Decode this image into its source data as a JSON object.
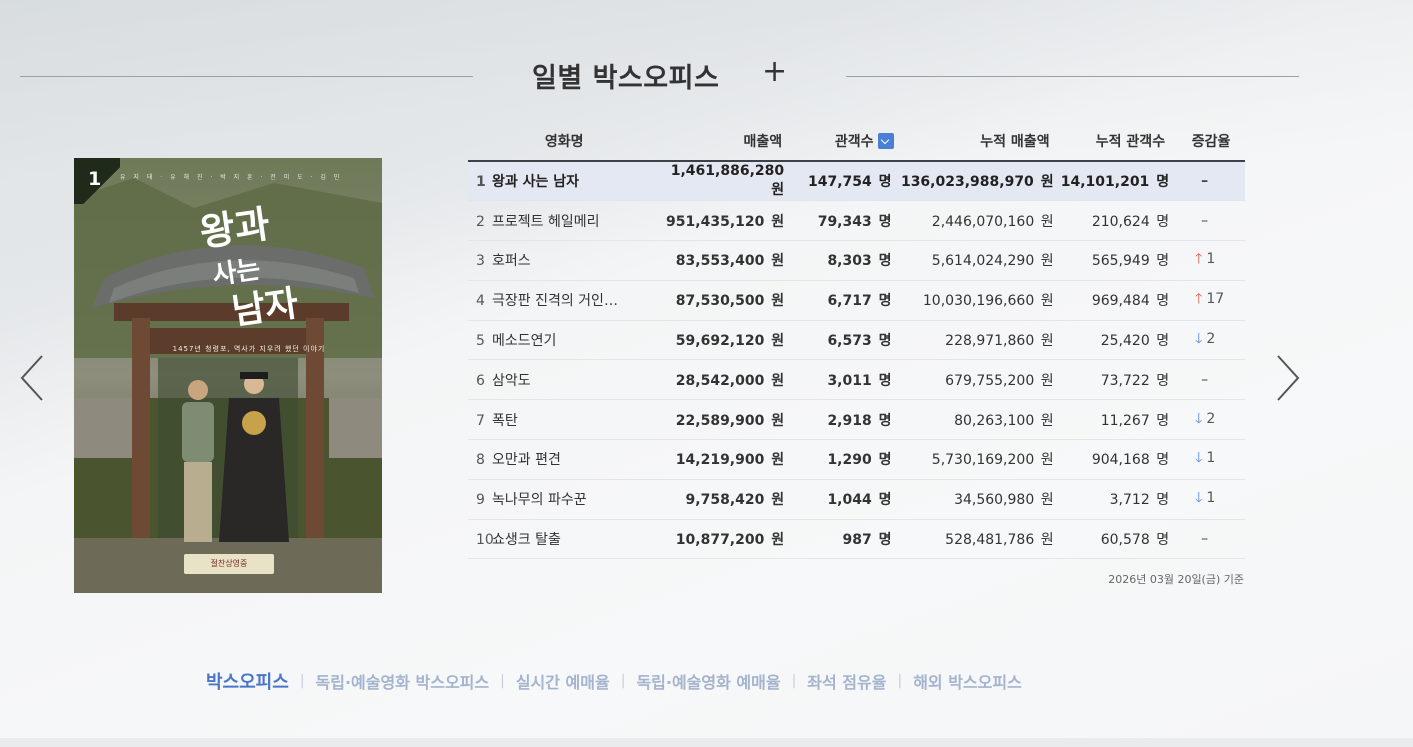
{
  "header": {
    "title": "일별 박스오피스",
    "plus_label": "+"
  },
  "poster": {
    "rank": "1",
    "credits": "유 지 태 · 유 해 진 · 박 지 훈 · 전 미 도 · 김 민",
    "tagline": "1457년 청령포, 역사가 지우려 했던 이야기",
    "release": "절찬상영중"
  },
  "columns": {
    "name": "영화명",
    "sales": "매출액",
    "audience": "관객수",
    "cum_sales": "누적 매출액",
    "cum_audience": "누적 관객수",
    "change": "증감율"
  },
  "units": {
    "won": "원",
    "people": "명"
  },
  "rows": [
    {
      "rank": "1",
      "name": "왕과 사는 남자",
      "sales": "1,461,886,280",
      "audience": "147,754",
      "cum_sales": "136,023,988,970",
      "cum_audience": "14,101,201",
      "change_dir": "none",
      "change_symbol": "–",
      "change": ""
    },
    {
      "rank": "2",
      "name": "프로젝트 헤일메리",
      "sales": "951,435,120",
      "audience": "79,343",
      "cum_sales": "2,446,070,160",
      "cum_audience": "210,624",
      "change_dir": "none",
      "change_symbol": "–",
      "change": ""
    },
    {
      "rank": "3",
      "name": "호퍼스",
      "sales": "83,553,400",
      "audience": "8,303",
      "cum_sales": "5,614,024,290",
      "cum_audience": "565,949",
      "change_dir": "up",
      "change_symbol": "🡑",
      "change": "1"
    },
    {
      "rank": "4",
      "name": "극장판 진격의 거인…",
      "sales": "87,530,500",
      "audience": "6,717",
      "cum_sales": "10,030,196,660",
      "cum_audience": "969,484",
      "change_dir": "up",
      "change_symbol": "🡑",
      "change": "17"
    },
    {
      "rank": "5",
      "name": "메소드연기",
      "sales": "59,692,120",
      "audience": "6,573",
      "cum_sales": "228,971,860",
      "cum_audience": "25,420",
      "change_dir": "down",
      "change_symbol": "🡓",
      "change": "2"
    },
    {
      "rank": "6",
      "name": "삼악도",
      "sales": "28,542,000",
      "audience": "3,011",
      "cum_sales": "679,755,200",
      "cum_audience": "73,722",
      "change_dir": "none",
      "change_symbol": "–",
      "change": ""
    },
    {
      "rank": "7",
      "name": "폭탄",
      "sales": "22,589,900",
      "audience": "2,918",
      "cum_sales": "80,263,100",
      "cum_audience": "11,267",
      "change_dir": "down",
      "change_symbol": "🡓",
      "change": "2"
    },
    {
      "rank": "8",
      "name": "오만과 편견",
      "sales": "14,219,900",
      "audience": "1,290",
      "cum_sales": "5,730,169,200",
      "cum_audience": "904,168",
      "change_dir": "down",
      "change_symbol": "🡓",
      "change": "1"
    },
    {
      "rank": "9",
      "name": "녹나무의 파수꾼",
      "sales": "9,758,420",
      "audience": "1,044",
      "cum_sales": "34,560,980",
      "cum_audience": "3,712",
      "change_dir": "down",
      "change_symbol": "🡓",
      "change": "1"
    },
    {
      "rank": "10",
      "name": "쇼생크 탈출",
      "sales": "10,877,200",
      "audience": "987",
      "cum_sales": "528,481,786",
      "cum_audience": "60,578",
      "change_dir": "none",
      "change_symbol": "–",
      "change": ""
    }
  ],
  "footnote": "2026년 03월 20일(금) 기준",
  "tabs": [
    {
      "label": "박스오피스",
      "active": true
    },
    {
      "label": "독립·예술영화 박스오피스",
      "active": false
    },
    {
      "label": "실시간 예매율",
      "active": false
    },
    {
      "label": "독립·예술영화 예매율",
      "active": false
    },
    {
      "label": "좌석 점유율",
      "active": false
    },
    {
      "label": "해외 박스오피스",
      "active": false
    }
  ],
  "colors": {
    "accent": "#4a76c9",
    "tab_inactive": "#a5b3cf",
    "up": "#e05a4a",
    "down": "#5a8ae6",
    "top_row_bg": "#e4e8f2"
  },
  "icons": {
    "prev": "chevron-left-icon",
    "next": "chevron-right-icon",
    "sort": "sort-down-icon"
  }
}
